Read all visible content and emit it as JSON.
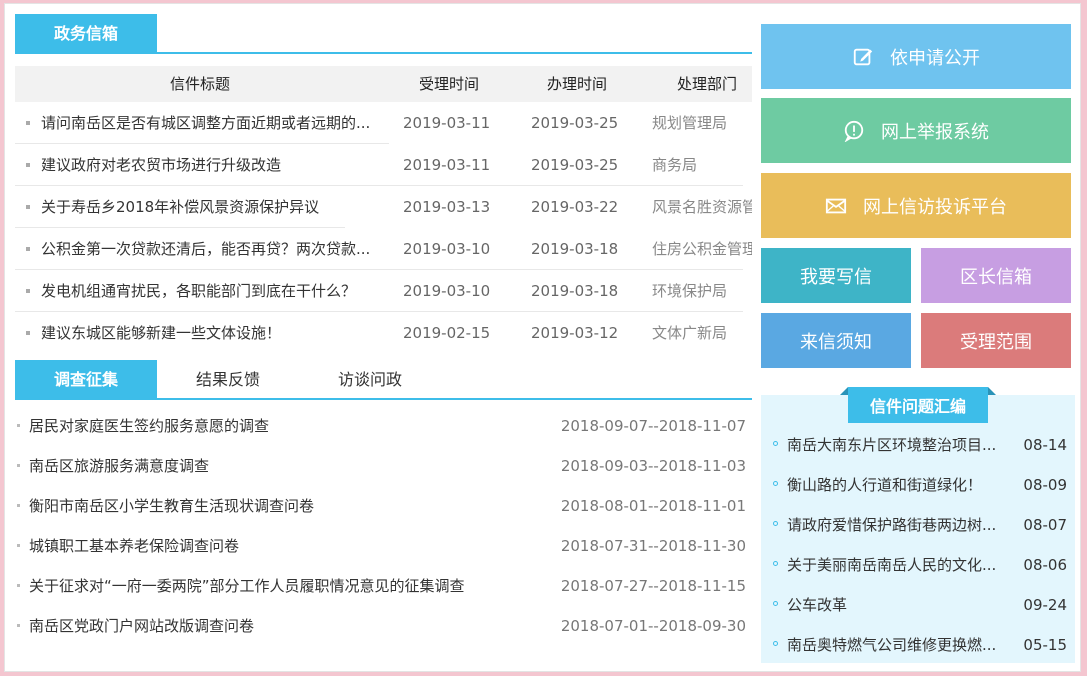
{
  "mailbox": {
    "tab_label": "政务信箱",
    "columns": [
      "信件标题",
      "受理时间",
      "办理时间",
      "处理部门"
    ],
    "rows": [
      {
        "title": "请问南岳区是否有城区调整方面近期或者远期的...",
        "received": "2019-03-11",
        "handled": "2019-03-25",
        "dept": "规划管理局"
      },
      {
        "title": "建议政府对老农贸市场进行升级改造",
        "received": "2019-03-11",
        "handled": "2019-03-25",
        "dept": "商务局"
      },
      {
        "title": "关于寿岳乡2018年补偿风景资源保护异议",
        "received": "2019-03-13",
        "handled": "2019-03-22",
        "dept": "风景名胜资源管"
      },
      {
        "title": "公积金第一次贷款还清后，能否再贷？两次贷款...",
        "received": "2019-03-10",
        "handled": "2019-03-18",
        "dept": "住房公积金管理"
      },
      {
        "title": "发电机组通宵扰民，各职能部门到底在干什么？",
        "received": "2019-03-10",
        "handled": "2019-03-18",
        "dept": "环境保护局"
      },
      {
        "title": "建议东城区能够新建一些文体设施！",
        "received": "2019-02-15",
        "handled": "2019-03-12",
        "dept": "文体广新局"
      }
    ]
  },
  "survey": {
    "tabs": [
      "调查征集",
      "结果反馈",
      "访谈问政"
    ],
    "items": [
      {
        "title": "居民对家庭医生签约服务意愿的调查",
        "period": "2018-09-07--2018-11-07"
      },
      {
        "title": "南岳区旅游服务满意度调查",
        "period": "2018-09-03--2018-11-03"
      },
      {
        "title": "衡阳市南岳区小学生教育生活现状调查问卷",
        "period": "2018-08-01--2018-11-01"
      },
      {
        "title": "城镇职工基本养老保险调查问卷",
        "period": "2018-07-31--2018-11-30"
      },
      {
        "title": "关于征求对“一府一委两院”部分工作人员履职情况意见的征集调查",
        "period": "2018-07-27--2018-11-15"
      },
      {
        "title": "南岳区党政门户网站改版调查问卷",
        "period": "2018-07-01--2018-09-30"
      }
    ]
  },
  "actions": {
    "apply_open": {
      "label": "依申请公开",
      "icon": "edit-icon",
      "color": "#6fc3ef"
    },
    "report_system": {
      "label": "网上举报系统",
      "icon": "alert-icon",
      "color": "#6ecba2"
    },
    "petition": {
      "label": "网上信访投诉平台",
      "icon": "mail-icon",
      "color": "#e9bd5a"
    },
    "write_letter": {
      "label": "我要写信",
      "color": "#3eb4c7"
    },
    "district_mailbox": {
      "label": "区长信箱",
      "color": "#c79ee2"
    },
    "letter_notice": {
      "label": "来信须知",
      "color": "#5aa8e2"
    },
    "scope": {
      "label": "受理范围",
      "color": "#db7b7b"
    }
  },
  "summary": {
    "title": "信件问题汇编",
    "items": [
      {
        "title": "南岳大南东片区环境整治项目...",
        "date": "08-14"
      },
      {
        "title": "衡山路的人行道和街道绿化！",
        "date": "08-09"
      },
      {
        "title": "请政府爱惜保护路街巷两边树...",
        "date": "08-07"
      },
      {
        "title": "关于美丽南岳南岳人民的文化...",
        "date": "08-06"
      },
      {
        "title": "公车改革",
        "date": "09-24"
      },
      {
        "title": "南岳奥特燃气公司维修更换燃...",
        "date": "05-15"
      }
    ]
  }
}
